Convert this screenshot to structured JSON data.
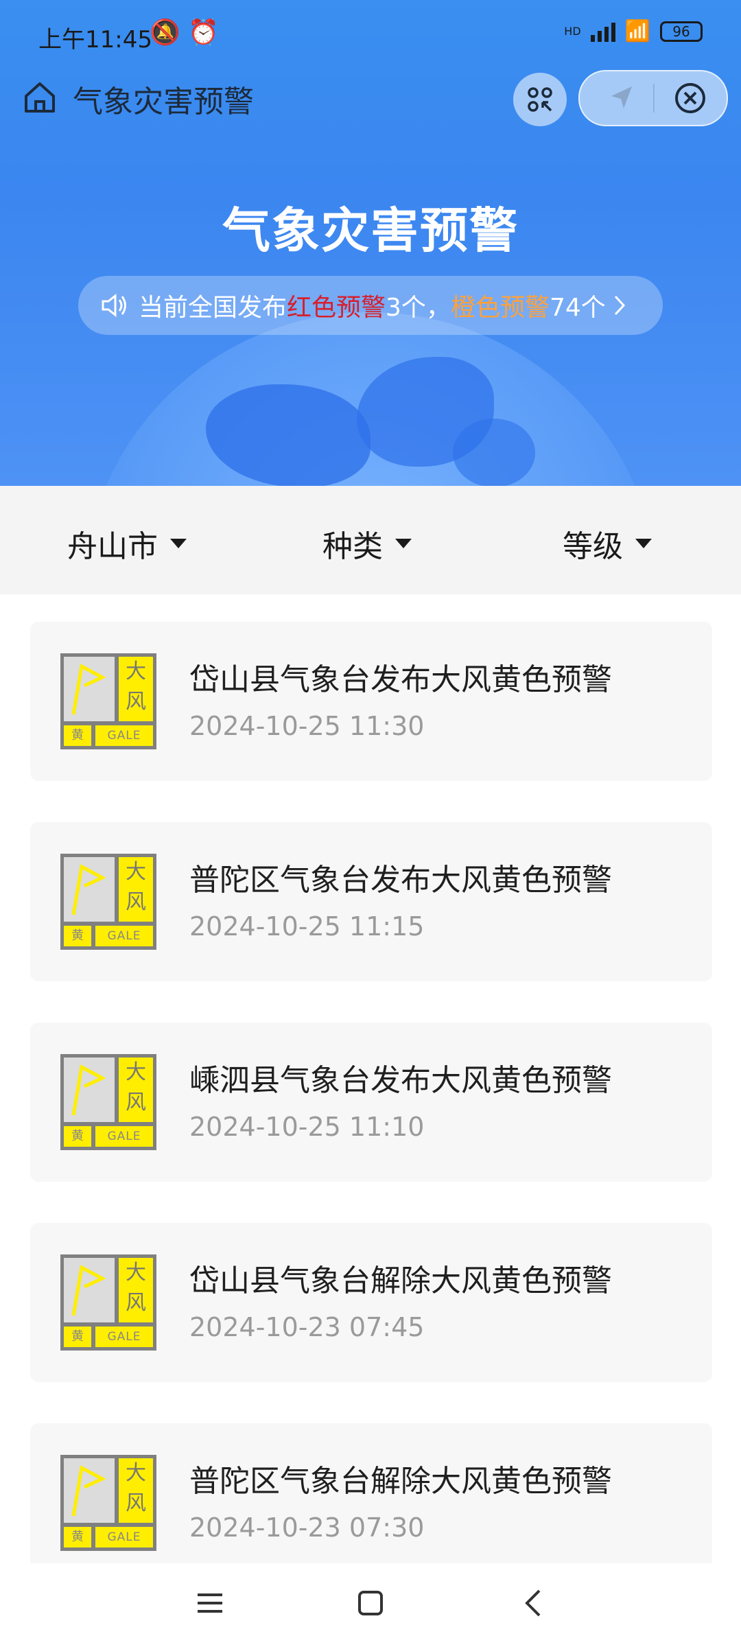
{
  "status_bar": {
    "time": "上午11:45",
    "battery": "96"
  },
  "nav": {
    "title": "气象灾害预警"
  },
  "hero": {
    "title": "气象灾害预警",
    "notice": {
      "prefix": "当前全国发布",
      "red_label": "红色预警",
      "red_count": "3个，",
      "orange_label": "橙色预警",
      "orange_count": "74个"
    }
  },
  "filters": [
    {
      "label": "舟山市"
    },
    {
      "label": "种类"
    },
    {
      "label": "等级"
    }
  ],
  "warnings": [
    {
      "title": "岱山县气象台发布大风黄色预警",
      "time": "2024-10-25 11:30"
    },
    {
      "title": "普陀区气象台发布大风黄色预警",
      "time": "2024-10-25 11:15"
    },
    {
      "title": "嵊泗县气象台发布大风黄色预警",
      "time": "2024-10-25 11:10"
    },
    {
      "title": "岱山县气象台解除大风黄色预警",
      "time": "2024-10-23 07:45"
    },
    {
      "title": "普陀区气象台解除大风黄色预警",
      "time": "2024-10-23 07:30"
    }
  ],
  "warning_icon": {
    "big": "大风",
    "level": "黄",
    "code": "GALE"
  },
  "colors": {
    "header_blue": "#3a8ff0",
    "red_warning": "#d81e2a",
    "orange_warning": "#ffa13a",
    "yellow_icon": "#ffee00"
  }
}
